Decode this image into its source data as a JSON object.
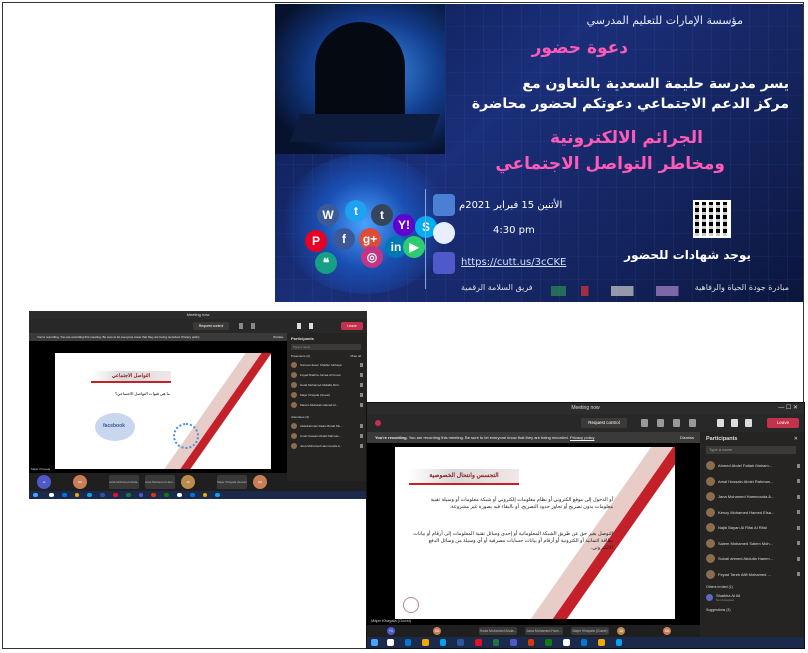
{
  "poster": {
    "org": "مؤسسة الإمارات للتعليم المدرسي",
    "invite": "دعوة حضور",
    "line1": "يسر مدرسة حليمة السعدية بالتعاون مع",
    "line2": "مركز الدعم الاجتماعي دعوتكم لحضور محاضرة",
    "title1": "الجرائم الالكترونية",
    "title2": "ومخاطر التواصل الاجتماعي",
    "date": "الأثنين 15 فبراير 2021م",
    "time": "4:30 pm",
    "link": "https://cutt.us/3cCKE",
    "certificate": "يوجد شهادات للحضور",
    "team": "فريق السلامة الرقمية",
    "initiative": "مبادرة جودة الحياة والرفاهية",
    "social": [
      {
        "glyph": "W",
        "color": "#3d5a98"
      },
      {
        "glyph": "t",
        "color": "#1da1f2"
      },
      {
        "glyph": "t",
        "color": "#35465c"
      },
      {
        "glyph": "Y!",
        "color": "#6001d2"
      },
      {
        "glyph": "S",
        "color": "#00aff0"
      },
      {
        "glyph": "P",
        "color": "#e60023"
      },
      {
        "glyph": "f",
        "color": "#3b5998"
      },
      {
        "glyph": "g+",
        "color": "#dd4b39"
      },
      {
        "glyph": "in",
        "color": "#0077b5"
      },
      {
        "glyph": "◎",
        "color": "#c13584"
      },
      {
        "glyph": "▶",
        "color": "#2ecc71"
      },
      {
        "glyph": "❝",
        "color": "#16a085"
      }
    ]
  },
  "teams_small": {
    "title": "Meeting now",
    "request_control": "Request control",
    "leave": "Leave",
    "recording": "You're recording. You are recording this meeting. Be sure to let everyone know that they are being recorded. Privacy policy",
    "dismiss": "Dismiss",
    "slide_header": "التواصل الاجتماعي",
    "slide_question": "ما هي قنوات التواصل الاجتماعي؟",
    "facebook": "facebook",
    "presenter": "Majer Khayala",
    "participants_title": "Participants",
    "search_placeholder": "Type a name",
    "presenters_label": "Presenters (2)",
    "mute_all": "Mute all",
    "attendees_label": "Attendees (3)",
    "presenters": [
      {
        "name": "Sumaa Husen Shalbur Alshaya"
      },
      {
        "name": "Feyad Rakhia Jumaa Al Kmem"
      },
      {
        "name": "Hoda Mohamed Abdalla Moh..."
      },
      {
        "name": "Majer Khayala (Guest)"
      },
      {
        "name": "Maram Mubarak Hamad Al..."
      }
    ],
    "attendees": [
      {
        "name": "Abdelrahman Reda Morad Mu..."
      },
      {
        "name": "Amal Hossain Abdel Rahman..."
      },
      {
        "name": "Jana Mohamed Hammouda A..."
      }
    ],
    "tiles": [
      {
        "label": "+1"
      },
      {
        "label": "SA"
      },
      {
        "label": "Hoda Mohamed Abda..."
      },
      {
        "label": "Jana Mohamed Ham..."
      },
      {
        "label": "JA"
      },
      {
        "label": "Majer Khayala (Guest)"
      },
      {
        "label": "SA"
      }
    ]
  },
  "teams_large": {
    "title": "Meeting now",
    "request_control": "Request control",
    "leave": "Leave",
    "recording_bold": "You're recording.",
    "recording": "You are recording this meeting. Be sure to let everyone know that they are being recorded.",
    "privacy": "Privacy policy",
    "dismiss": "Dismiss",
    "slide_header": "التجسس وانتحال الخصوصية",
    "bullet1": "أو الدخول إلى موقع الكتروني أو نظام معلومات إلكتروني أو شبكة معلومات أو وسيلة تقنية معلومات بدون تصريح أو تجاوز حدود التصريح، أو بالبقاء فيه بصورة غير مشروعة.",
    "bullet2": "التوصل بغير حق عن طريق الشبكة المعلوماتية أو إحدى وسائل تقنية المعلومات إلى أرقام أو بيانات بطاقة ائتمانية أو الكترونية أو أرقام أو بيانات حسابات مصرفية أو أي وسيلة من وسائل الدفع الالكتروني.",
    "presenter": "Majer Khayala (Guest)",
    "participants_title": "Participants",
    "search_placeholder": "Type a name",
    "participants": [
      {
        "name": "Ahmed Abdel Fattah Moham..."
      },
      {
        "name": "Amal Hossain Abdel Rahman..."
      },
      {
        "name": "Jana Mohamed Hammouda A..."
      },
      {
        "name": "Kenzy Mohamed Hamed Elsa..."
      },
      {
        "name": "Najib Bayan Al Rifai Al Rifai"
      },
      {
        "name": "Salem Mohamed Salem Moh..."
      },
      {
        "name": "Suhail ahmed Abdulla Hamm..."
      },
      {
        "name": "Feyad Tarek Afifi Mohamed ..."
      }
    ],
    "others_label": "Others invited (1)",
    "other": {
      "name": "Shaikha Al Ali",
      "sub": "Not Accepted"
    },
    "suggestions": "Suggestions (3)",
    "tiles": [
      {
        "label": "+1"
      },
      {
        "label": "SA"
      },
      {
        "label": "Hoda Mohamed Abda..."
      },
      {
        "label": "Jana Mohamed Ham..."
      },
      {
        "label": "Majer Khayala (Guest)"
      },
      {
        "label": "JA"
      },
      {
        "label": "SA"
      }
    ]
  }
}
